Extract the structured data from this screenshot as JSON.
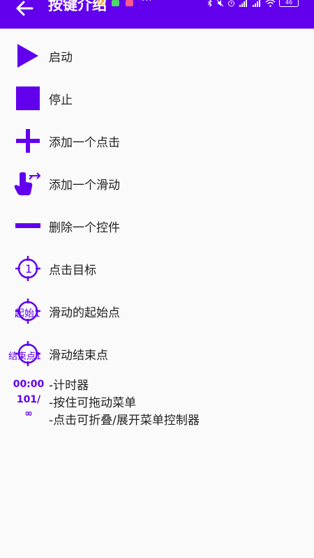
{
  "app": {
    "title": "按键介绍"
  },
  "status_bar": {
    "overflow": "···",
    "battery": "46",
    "icons": [
      "bluetooth-icon",
      "mute-icon",
      "alarm-icon",
      "signal-icon",
      "signal-icon",
      "wifi-icon",
      "battery-icon"
    ]
  },
  "colors": {
    "accent": "#6200ee",
    "background": "#fafafa",
    "text": "#222222"
  },
  "items": [
    {
      "icon": "play-icon",
      "label": "启动"
    },
    {
      "icon": "stop-icon",
      "label": "停止"
    },
    {
      "icon": "plus-icon",
      "label": "添加一个点击"
    },
    {
      "icon": "swipe-hand-icon",
      "label": "添加一个滑动"
    },
    {
      "icon": "minus-icon",
      "label": "删除一个控件"
    },
    {
      "icon": "crosshair-target-icon",
      "label": "点击目标",
      "icon_text": "1"
    },
    {
      "icon": "crosshair-swipe-start-icon",
      "label": "滑动的起始点",
      "icon_text": "起始1"
    },
    {
      "icon": "crosshair-swipe-end-icon",
      "label": "滑动结束点",
      "icon_text": "结束点1"
    }
  ],
  "timer": {
    "time": "00:00",
    "count": "101/",
    "infinity": "∞"
  },
  "descriptions": [
    "-计时器",
    "-按住可拖动菜单",
    "-点击可折叠/展开菜单控制器"
  ]
}
